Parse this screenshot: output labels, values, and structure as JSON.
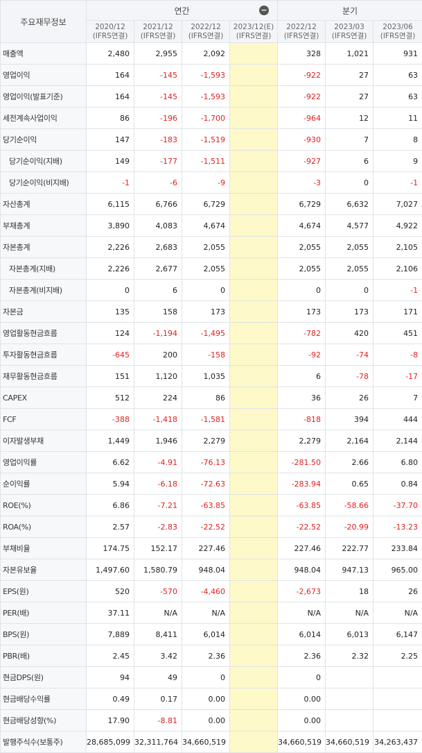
{
  "header": {
    "corner_label": "주요재무정보",
    "annual_label": "연간",
    "quarterly_label": "분기",
    "collapse_icon": "minus-circle-icon",
    "annual_periods": [
      {
        "year": "2020/12",
        "basis": "(IFRS연결)"
      },
      {
        "year": "2021/12",
        "basis": "(IFRS연결)"
      },
      {
        "year": "2022/12",
        "basis": "(IFRS연결)"
      },
      {
        "year": "2023/12(E)",
        "basis": "(IFRS연결)"
      }
    ],
    "quarterly_periods": [
      {
        "year": "2022/12",
        "basis": "(IFRS연결)"
      },
      {
        "year": "2023/03",
        "basis": "(IFRS연결)"
      },
      {
        "year": "2023/06",
        "basis": "(IFRS연결)"
      }
    ]
  },
  "colors": {
    "negative": "#e02020",
    "estimate_bg": "#fdf9c9",
    "header_bg": "#f3f5f8"
  },
  "rows": [
    {
      "label": "매출액",
      "sub": false,
      "values": [
        "2,480",
        "2,955",
        "2,092",
        "",
        "328",
        "1,021",
        "931"
      ]
    },
    {
      "label": "영업이익",
      "sub": false,
      "values": [
        "164",
        "-145",
        "-1,593",
        "",
        "-922",
        "27",
        "63"
      ]
    },
    {
      "label": "영업이익(발표기준)",
      "sub": false,
      "values": [
        "164",
        "-145",
        "-1,593",
        "",
        "-922",
        "27",
        "63"
      ]
    },
    {
      "label": "세전계속사업이익",
      "sub": false,
      "values": [
        "86",
        "-196",
        "-1,700",
        "",
        "-964",
        "12",
        "11"
      ]
    },
    {
      "label": "당기순이익",
      "sub": false,
      "values": [
        "147",
        "-183",
        "-1,519",
        "",
        "-930",
        "7",
        "8"
      ]
    },
    {
      "label": "당기순이익(지배)",
      "sub": true,
      "values": [
        "149",
        "-177",
        "-1,511",
        "",
        "-927",
        "6",
        "9"
      ]
    },
    {
      "label": "당기순이익(비지배)",
      "sub": true,
      "values": [
        "-1",
        "-6",
        "-9",
        "",
        "-3",
        "0",
        "-1"
      ]
    },
    {
      "label": "자산총계",
      "sub": false,
      "values": [
        "6,115",
        "6,766",
        "6,729",
        "",
        "6,729",
        "6,632",
        "7,027"
      ]
    },
    {
      "label": "부채총계",
      "sub": false,
      "values": [
        "3,890",
        "4,083",
        "4,674",
        "",
        "4,674",
        "4,577",
        "4,922"
      ]
    },
    {
      "label": "자본총계",
      "sub": false,
      "values": [
        "2,226",
        "2,683",
        "2,055",
        "",
        "2,055",
        "2,055",
        "2,105"
      ]
    },
    {
      "label": "자본총계(지배)",
      "sub": true,
      "values": [
        "2,226",
        "2,677",
        "2,055",
        "",
        "2,055",
        "2,055",
        "2,106"
      ]
    },
    {
      "label": "자본총계(비지배)",
      "sub": true,
      "values": [
        "0",
        "6",
        "0",
        "",
        "0",
        "0",
        "-1"
      ]
    },
    {
      "label": "자본금",
      "sub": false,
      "values": [
        "135",
        "158",
        "173",
        "",
        "173",
        "173",
        "171"
      ]
    },
    {
      "label": "영업활동현금흐름",
      "sub": false,
      "values": [
        "124",
        "-1,194",
        "-1,495",
        "",
        "-782",
        "420",
        "451"
      ]
    },
    {
      "label": "투자활동현금흐름",
      "sub": false,
      "values": [
        "-645",
        "200",
        "-158",
        "",
        "-92",
        "-74",
        "-8"
      ]
    },
    {
      "label": "재무활동현금흐름",
      "sub": false,
      "values": [
        "151",
        "1,120",
        "1,035",
        "",
        "6",
        "-78",
        "-17"
      ]
    },
    {
      "label": "CAPEX",
      "sub": false,
      "values": [
        "512",
        "224",
        "86",
        "",
        "36",
        "26",
        "7"
      ]
    },
    {
      "label": "FCF",
      "sub": false,
      "values": [
        "-388",
        "-1,418",
        "-1,581",
        "",
        "-818",
        "394",
        "444"
      ]
    },
    {
      "label": "이자발생부채",
      "sub": false,
      "values": [
        "1,449",
        "1,946",
        "2,279",
        "",
        "2,279",
        "2,164",
        "2,144"
      ]
    },
    {
      "label": "영업이익률",
      "sub": false,
      "values": [
        "6.62",
        "-4.91",
        "-76.13",
        "",
        "-281.50",
        "2.66",
        "6.80"
      ]
    },
    {
      "label": "순이익률",
      "sub": false,
      "values": [
        "5.94",
        "-6.18",
        "-72.63",
        "",
        "-283.94",
        "0.65",
        "0.84"
      ]
    },
    {
      "label": "ROE(%)",
      "sub": false,
      "values": [
        "6.86",
        "-7.21",
        "-63.85",
        "",
        "-63.85",
        "-58.66",
        "-37.70"
      ]
    },
    {
      "label": "ROA(%)",
      "sub": false,
      "values": [
        "2.57",
        "-2.83",
        "-22.52",
        "",
        "-22.52",
        "-20.99",
        "-13.23"
      ]
    },
    {
      "label": "부채비율",
      "sub": false,
      "values": [
        "174.75",
        "152.17",
        "227.46",
        "",
        "227.46",
        "222.77",
        "233.84"
      ]
    },
    {
      "label": "자본유보율",
      "sub": false,
      "values": [
        "1,497.60",
        "1,580.79",
        "948.04",
        "",
        "948.04",
        "947.13",
        "965.00"
      ]
    },
    {
      "label": "EPS(원)",
      "sub": false,
      "values": [
        "520",
        "-570",
        "-4,460",
        "",
        "-2,673",
        "18",
        "26"
      ]
    },
    {
      "label": "PER(배)",
      "sub": false,
      "values": [
        "37.11",
        "N/A",
        "N/A",
        "",
        "N/A",
        "N/A",
        "N/A"
      ]
    },
    {
      "label": "BPS(원)",
      "sub": false,
      "values": [
        "7,889",
        "8,411",
        "6,014",
        "",
        "6,014",
        "6,013",
        "6,147"
      ]
    },
    {
      "label": "PBR(배)",
      "sub": false,
      "values": [
        "2.45",
        "3.42",
        "2.36",
        "",
        "2.36",
        "2.32",
        "2.25"
      ]
    },
    {
      "label": "현금DPS(원)",
      "sub": false,
      "values": [
        "94",
        "49",
        "0",
        "",
        "0",
        "",
        ""
      ]
    },
    {
      "label": "현금배당수익률",
      "sub": false,
      "values": [
        "0.49",
        "0.17",
        "0.00",
        "",
        "0.00",
        "",
        ""
      ]
    },
    {
      "label": "현금배당성향(%)",
      "sub": false,
      "values": [
        "17.90",
        "-8.81",
        "0.00",
        "",
        "0.00",
        "",
        ""
      ]
    },
    {
      "label": "발행주식수(보통주)",
      "sub": false,
      "values": [
        "28,685,099",
        "32,311,764",
        "34,660,519",
        "",
        "34,660,519",
        "34,660,519",
        "34,263,437"
      ]
    }
  ]
}
